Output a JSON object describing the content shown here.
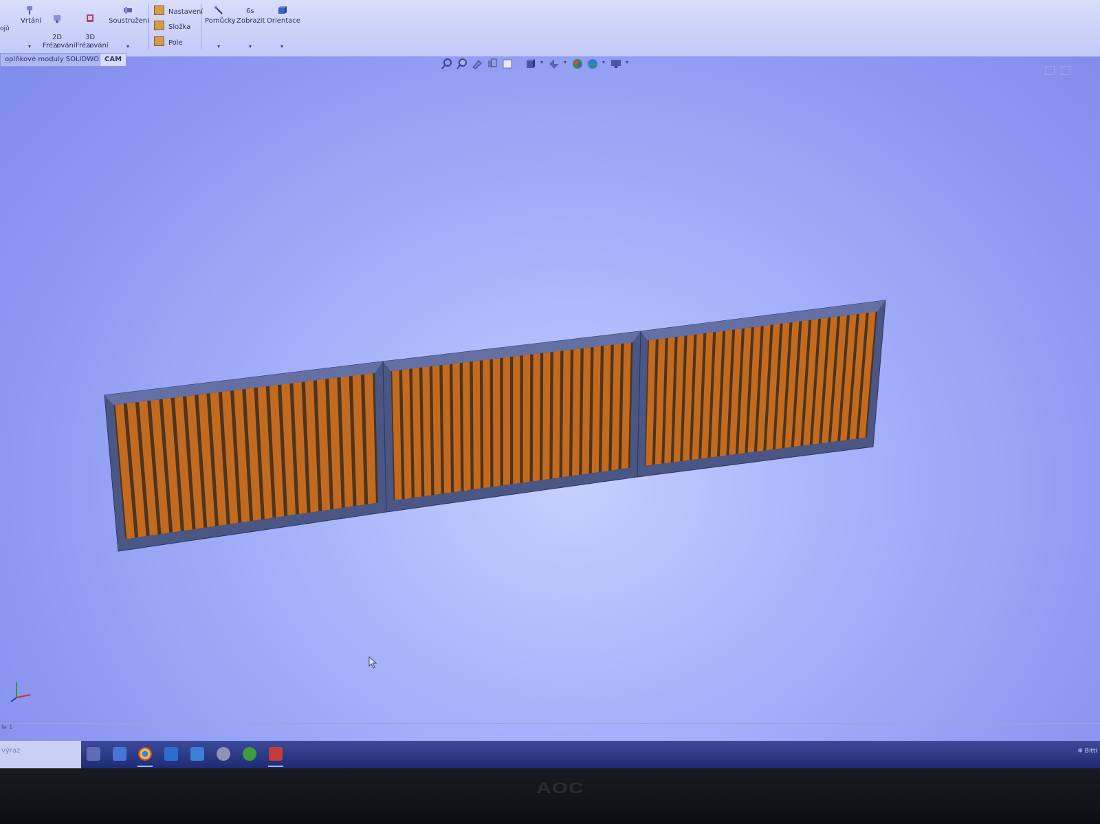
{
  "ribbon": {
    "cut_label": "ojů",
    "buttons": [
      {
        "label": "Vrtání"
      },
      {
        "label": "2D\nFrézování"
      },
      {
        "label": "3D\nFrézování"
      },
      {
        "label": "Soustružení"
      },
      {
        "label": "Pomůcky"
      },
      {
        "label": "Zobrazit"
      },
      {
        "label": "Orientace"
      }
    ],
    "small_items": [
      "Nastavení",
      "Složka",
      "Pole"
    ]
  },
  "tabs": {
    "addins": "oplňkové moduly SOLIDWORKS",
    "cam": "CAM"
  },
  "statusbar": {
    "left_text": "le 1"
  },
  "taskbar": {
    "search_placeholder": "výraz",
    "tray_text": "Bitti"
  },
  "monitor": {
    "brand": "AOC"
  },
  "colors": {
    "viewport_bg": "#a6b2fa",
    "frame": "#4a5684",
    "slat": "#c46a1e",
    "slat_gap": "#4b3520",
    "ribbon": "#d0d6fa",
    "taskbar": "#2a3786"
  },
  "icons": [
    "drill-icon",
    "mill-2d-icon",
    "mill-3d-icon",
    "turning-icon",
    "tools-icon",
    "display-icon",
    "orientation-icon",
    "zoom-to-fit-icon",
    "zoom-area-icon",
    "previous-view-icon",
    "section-view-icon",
    "view-orientation-icon",
    "display-style-icon",
    "hide-show-icon",
    "appearance-icon",
    "scene-icon",
    "view-settings-icon"
  ]
}
